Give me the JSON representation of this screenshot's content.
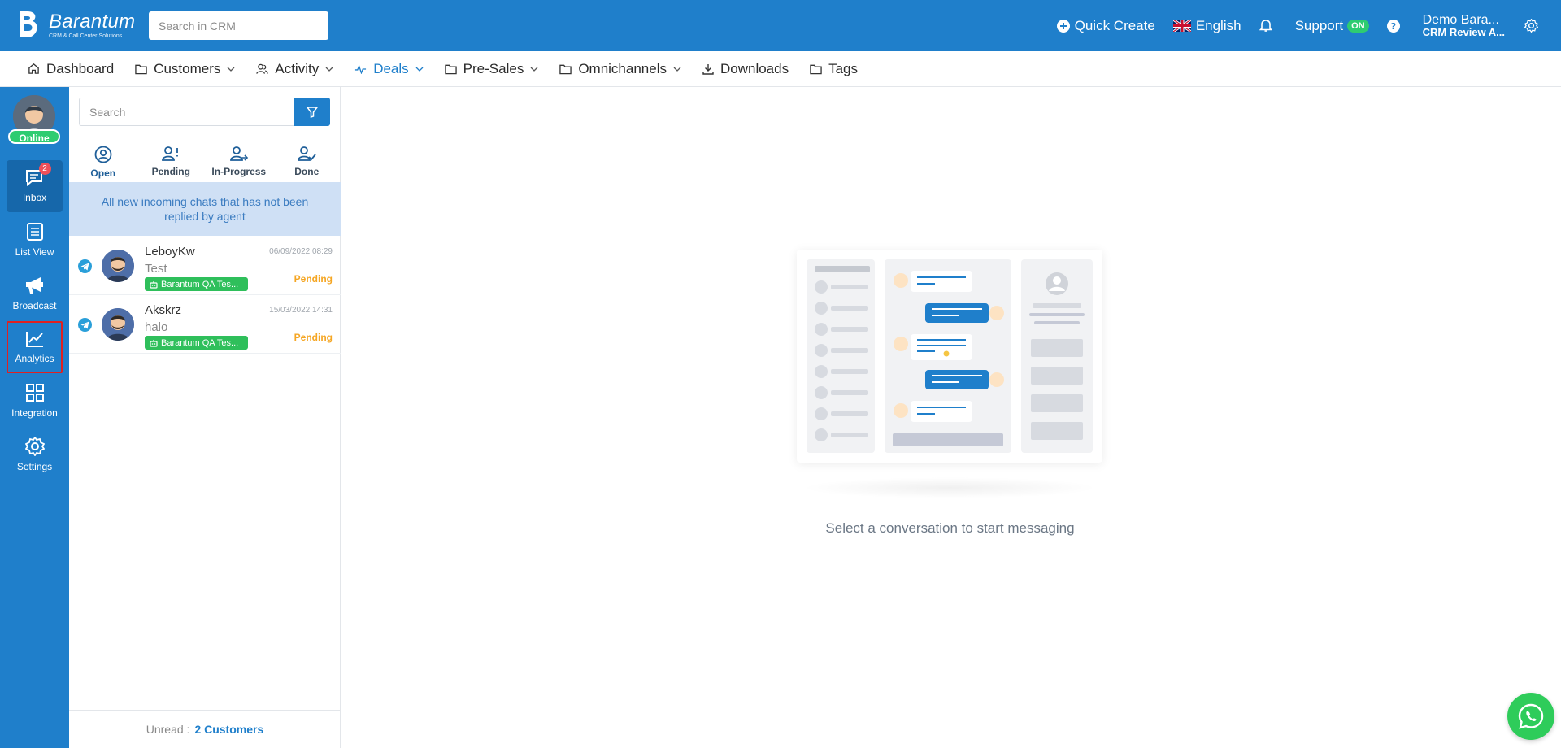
{
  "header": {
    "logo_name": "Barantum",
    "logo_sub": "CRM & Call Center Solutions",
    "search_placeholder": "Search in CRM",
    "quick_create": "Quick Create",
    "language": "English",
    "support": "Support",
    "support_badge": "ON",
    "user_name": "Demo Bara...",
    "user_org": "CRM Review A..."
  },
  "nav": {
    "items": [
      {
        "label": "Dashboard",
        "icon": "home-icon"
      },
      {
        "label": "Customers",
        "icon": "folder-icon"
      },
      {
        "label": "Activity",
        "icon": "users-icon"
      },
      {
        "label": "Deals",
        "icon": "pulse-icon"
      },
      {
        "label": "Pre-Sales",
        "icon": "folder-icon"
      },
      {
        "label": "Omnichannels",
        "icon": "folder-icon"
      },
      {
        "label": "Downloads",
        "icon": "download-icon"
      },
      {
        "label": "Tags",
        "icon": "folder-icon"
      }
    ]
  },
  "sidebar": {
    "status": "Online",
    "inbox_badge": "2",
    "items": [
      {
        "label": "Inbox",
        "icon": "chat-icon"
      },
      {
        "label": "List View",
        "icon": "list-icon"
      },
      {
        "label": "Broadcast",
        "icon": "megaphone-icon"
      },
      {
        "label": "Analytics",
        "icon": "chart-icon"
      },
      {
        "label": "Integration",
        "icon": "grid-icon"
      },
      {
        "label": "Settings",
        "icon": "gear-icon"
      }
    ]
  },
  "chatlist": {
    "search_placeholder": "Search",
    "tabs": [
      {
        "label": "Open"
      },
      {
        "label": "Pending"
      },
      {
        "label": "In-Progress"
      },
      {
        "label": "Done"
      }
    ],
    "info": "All new incoming chats that has not been replied by agent",
    "chats": [
      {
        "name": "LeboyKw",
        "time": "06/09/2022 08:29",
        "message": "Test",
        "tag": "Barantum QA Tes...",
        "status": "Pending"
      },
      {
        "name": "Akskrz",
        "time": "15/03/2022 14:31",
        "message": "halo",
        "tag": "Barantum QA Tes...",
        "status": "Pending"
      }
    ],
    "unread_label": "Unread :",
    "unread_count": "2 Customers"
  },
  "main": {
    "empty_message": "Select a conversation to start messaging"
  },
  "colors": {
    "brand": "#1f7fcb",
    "online": "#2ecc71",
    "pending": "#f5a623",
    "tag": "#2fbf5b",
    "whatsapp": "#2ecc5a"
  }
}
